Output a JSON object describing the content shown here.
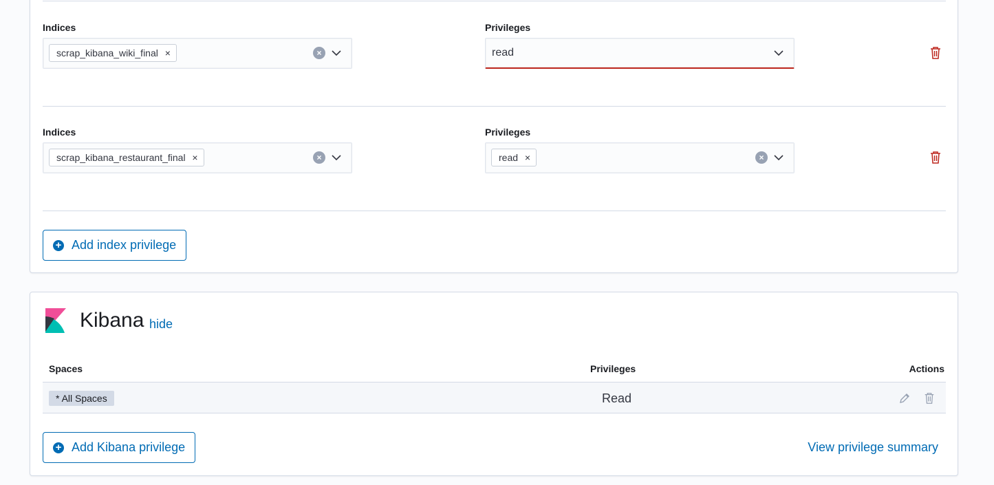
{
  "elasticsearch": {
    "index_rows": [
      {
        "indices_label": "Indices",
        "index_pill": "scrap_kibana_wiki_final",
        "privileges_label": "Privileges",
        "privileges_value": "read"
      },
      {
        "indices_label": "Indices",
        "index_pill": "scrap_kibana_restaurant_final",
        "privileges_label": "Privileges",
        "privilege_pill": "read"
      }
    ],
    "add_index_privilege": "Add index privilege"
  },
  "kibana": {
    "title": "Kibana",
    "hide_link": "hide",
    "table": {
      "headers": {
        "spaces": "Spaces",
        "privileges": "Privileges",
        "actions": "Actions"
      },
      "rows": [
        {
          "space": "* All Spaces",
          "privilege": "Read"
        }
      ]
    },
    "add_kibana_privilege": "Add Kibana privilege",
    "view_summary": "View privilege summary"
  },
  "icons": {
    "remove_pill": "×",
    "clear": "×",
    "plus": "+"
  },
  "colors": {
    "accent": "#006bb4",
    "danger": "#bd271e",
    "logo_pink": "#f04e98",
    "logo_teal": "#00bfb3",
    "logo_dark": "#343741"
  }
}
